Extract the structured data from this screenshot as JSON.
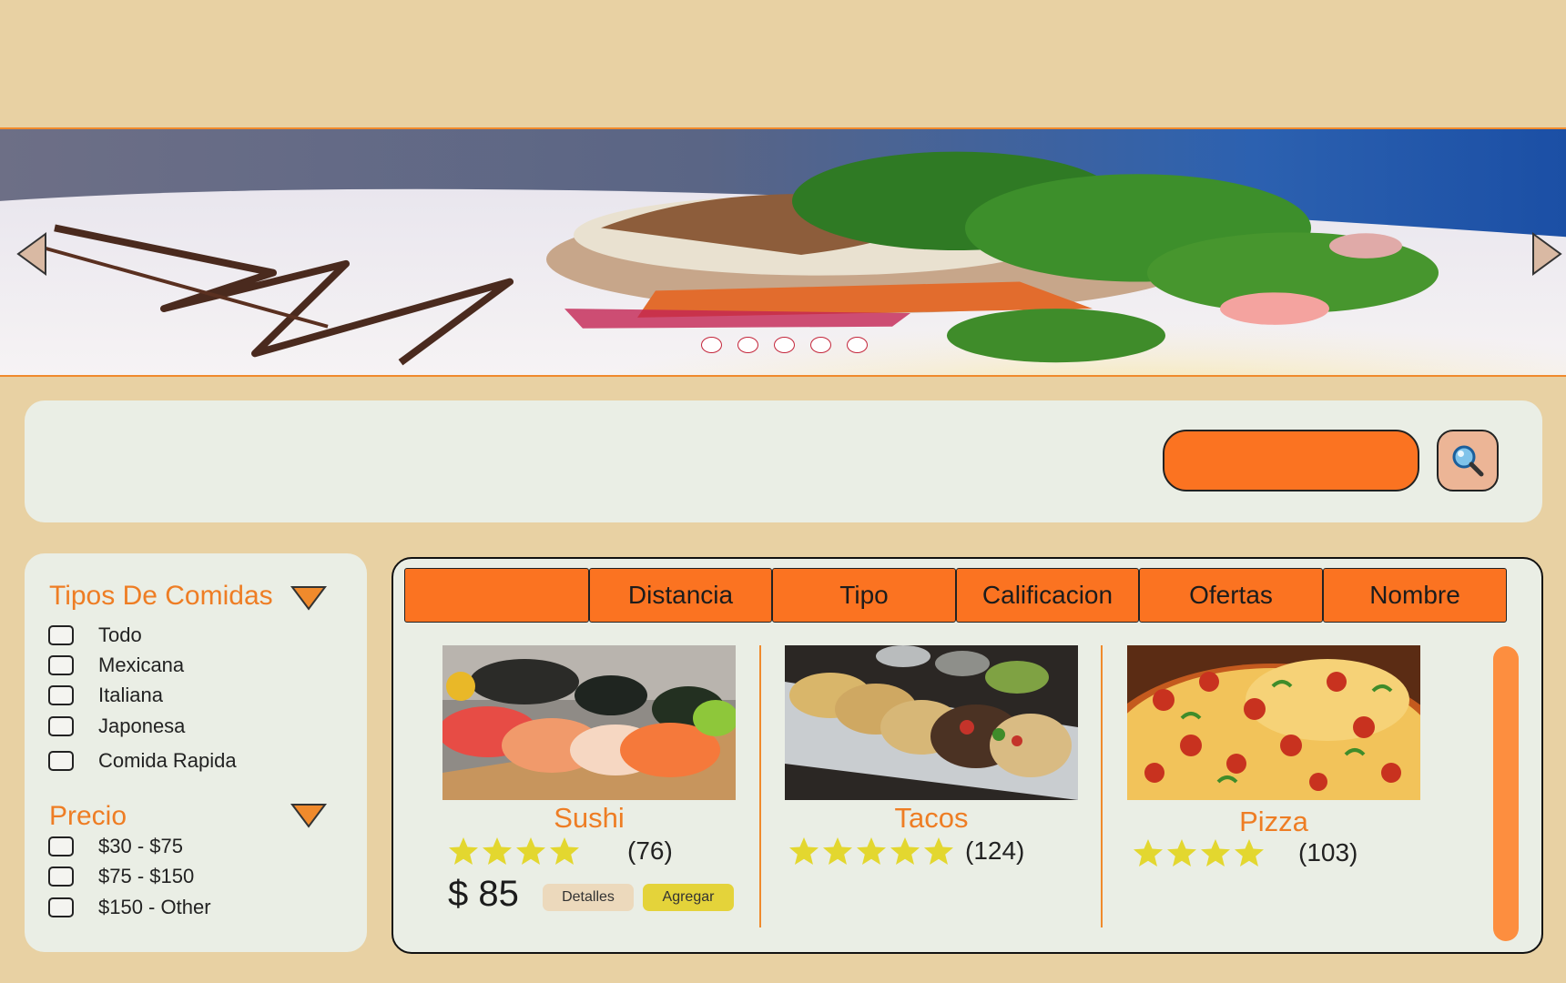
{
  "hero": {
    "slide_count": 5,
    "active_slide": 0,
    "prev_icon": "triangle-left-icon",
    "next_icon": "triangle-right-icon"
  },
  "search": {
    "value": "",
    "placeholder": "",
    "icon": "magnifier-icon"
  },
  "filters": {
    "food_types": {
      "title": "Tipos De Comidas",
      "options": [
        "Todo",
        "Mexicana",
        "Italiana",
        "Japonesa",
        "Comida Rapida"
      ]
    },
    "price": {
      "title": "Precio",
      "options": [
        "$30 - $75",
        "$75 - $150",
        "$150 - Other"
      ]
    }
  },
  "sort_tabs": [
    "",
    "Distancia",
    "Tipo",
    "Calificacion",
    "Ofertas",
    "Nombre"
  ],
  "cards": [
    {
      "name": "Sushi",
      "stars": 4,
      "count": "(76)",
      "price": "$ 85",
      "details_label": "Detalles",
      "add_label": "Agregar"
    },
    {
      "name": "Tacos",
      "stars": 5,
      "count": "(124)"
    },
    {
      "name": "Pizza",
      "stars": 4,
      "count": "(103)"
    }
  ],
  "colors": {
    "page_bg": "#e8d1a3",
    "panel_bg": "#eaeee5",
    "accent_orange": "#fb7321",
    "title_orange": "#ee7d24",
    "star_yellow": "#e3d72f"
  }
}
